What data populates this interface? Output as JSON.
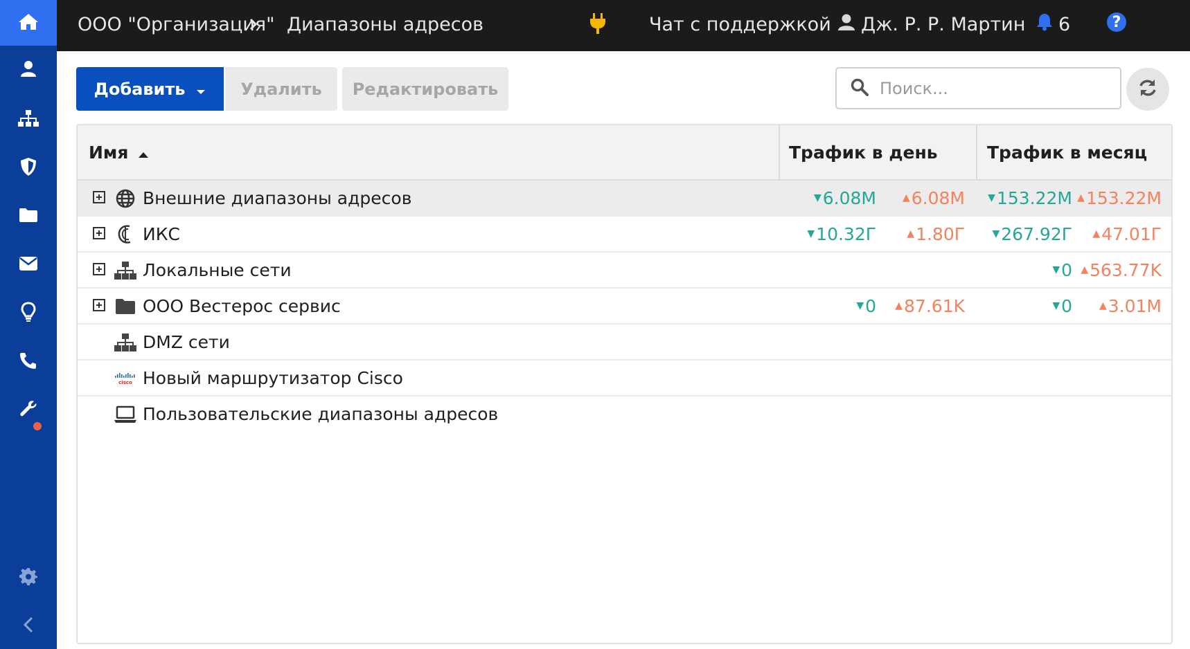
{
  "breadcrumb": {
    "org": "ООО \"Организация\"",
    "page": "Диапазоны адресов"
  },
  "topbar": {
    "chat": "Чат с поддержкой",
    "user": "Дж. Р. Р. Мартин",
    "notifications": "6",
    "help": "?"
  },
  "sidebar": {
    "items": [
      "home-icon",
      "user-icon",
      "sitemap-icon",
      "shield-icon",
      "folder-icon",
      "envelope-icon",
      "lightbulb-icon",
      "phone-icon",
      "wrench-icon",
      "gear-icon",
      "collapse-icon"
    ],
    "wrench_has_alert": true
  },
  "toolbar": {
    "add_label": "Добавить",
    "delete_label": "Удалить",
    "edit_label": "Редактировать"
  },
  "search": {
    "placeholder": "Поиск..."
  },
  "table": {
    "columns": {
      "name": "Имя",
      "traffic_day": "Трафик в день",
      "traffic_month": "Трафик в месяц"
    },
    "rows": [
      {
        "name": "Внешние диапазоны адресов",
        "icon": "globe-icon",
        "expandable": true,
        "selected": true,
        "day_down": "6.08M",
        "day_up": "6.08M",
        "month_down": "153.22M",
        "month_up": "153.22M"
      },
      {
        "name": "ИКС",
        "icon": "iks-logo-icon",
        "expandable": true,
        "day_down": "10.32Г",
        "day_up": "1.80Г",
        "month_down": "267.92Г",
        "month_up": "47.01Г"
      },
      {
        "name": "Локальные сети",
        "icon": "network-icon",
        "expandable": true,
        "day_down": "",
        "day_up": "",
        "month_down": "0",
        "month_up": "563.77K"
      },
      {
        "name": "ООО Вестерос сервис",
        "icon": "folder-icon",
        "expandable": true,
        "day_down": "0",
        "day_up": "87.61K",
        "month_down": "0",
        "month_up": "3.01M"
      },
      {
        "name": "DMZ сети",
        "icon": "network-icon",
        "expandable": false
      },
      {
        "name": "Новый маршрутизатор Cisco",
        "icon": "cisco-logo-icon",
        "expandable": false
      },
      {
        "name": "Пользовательские диапазоны адресов",
        "icon": "laptop-icon",
        "expandable": false
      }
    ]
  },
  "colors": {
    "sidebar": "#0b3e98",
    "accent": "#2f6ff0",
    "primary_button": "#0a4fbe",
    "down": "#23a897",
    "up": "#f2835e",
    "plug": "#f5b800"
  }
}
